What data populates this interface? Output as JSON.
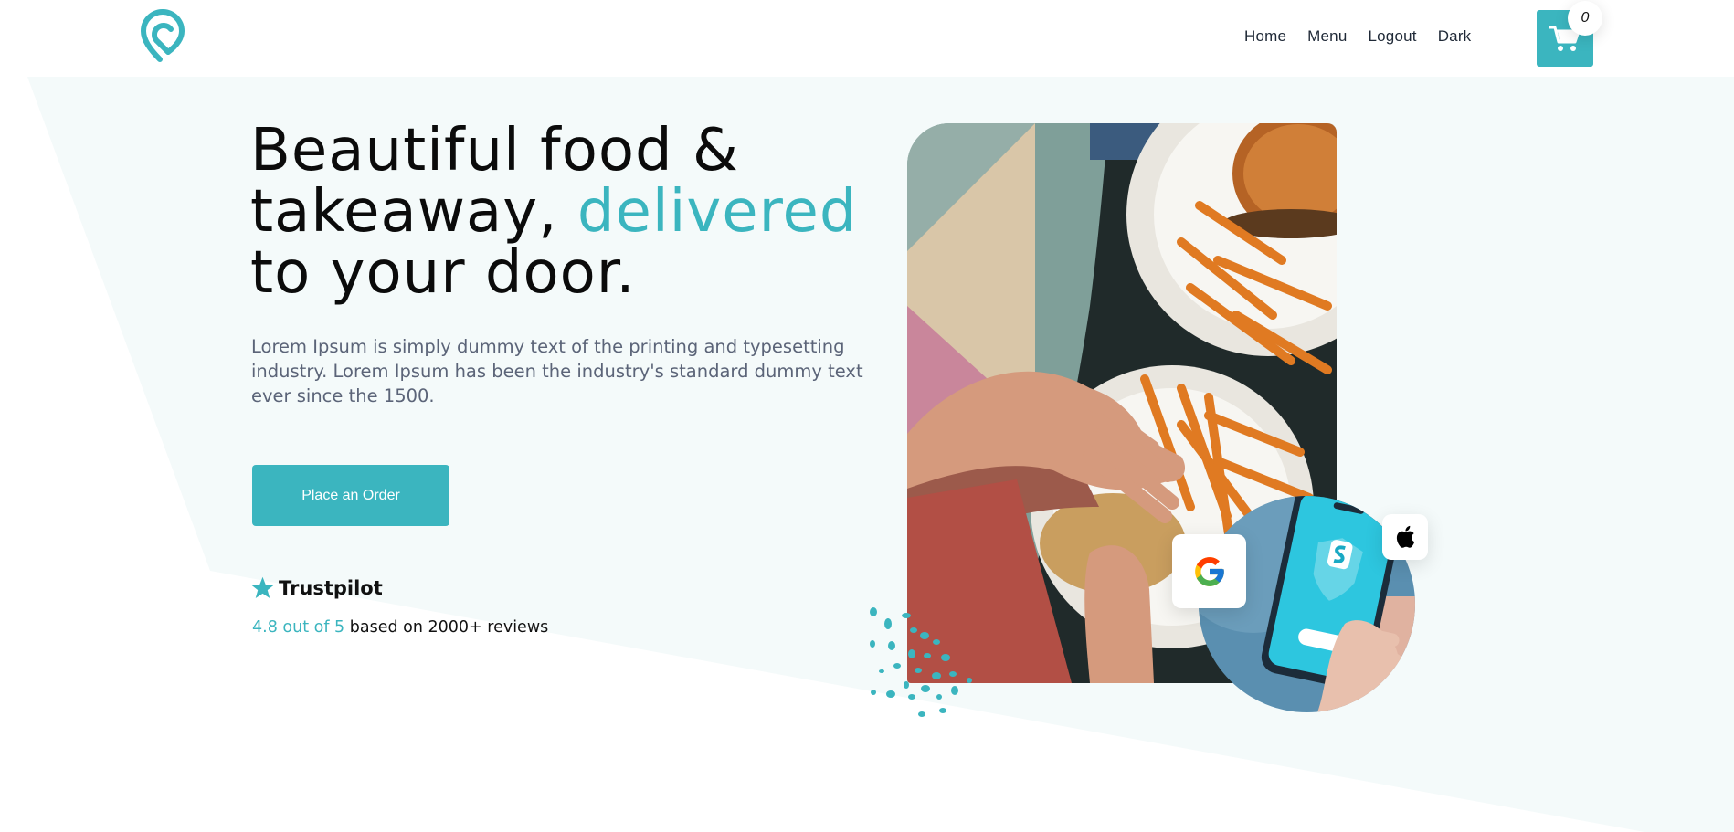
{
  "brand": {
    "logo_icon": "location-pin-logo-icon",
    "accent_color": "#3bb5bf"
  },
  "nav": {
    "items": [
      {
        "label": "Home"
      },
      {
        "label": "Menu"
      },
      {
        "label": "Logout"
      },
      {
        "label": "Dark"
      }
    ]
  },
  "cart": {
    "count": "0",
    "icon": "shopping-cart-icon"
  },
  "hero": {
    "headline_part1": "Beautiful food &",
    "headline_part2": "takeaway, ",
    "headline_accent": "delivered",
    "headline_part3": "to your door.",
    "description": "Lorem Ipsum is simply dummy text of the printing and typesetting industry. Lorem Ipsum has been the industry's standard dummy text ever since the 1500.",
    "cta_label": "Place an Order"
  },
  "trustpilot": {
    "icon": "star-icon",
    "name": "Trustpilot",
    "score": "4.8 out of 5",
    "reviews_text": " based on 2000+ reviews"
  },
  "media": {
    "main_image": "food-photo",
    "phone_image": "phone-app-image",
    "badges": [
      "google-icon",
      "apple-icon"
    ]
  }
}
